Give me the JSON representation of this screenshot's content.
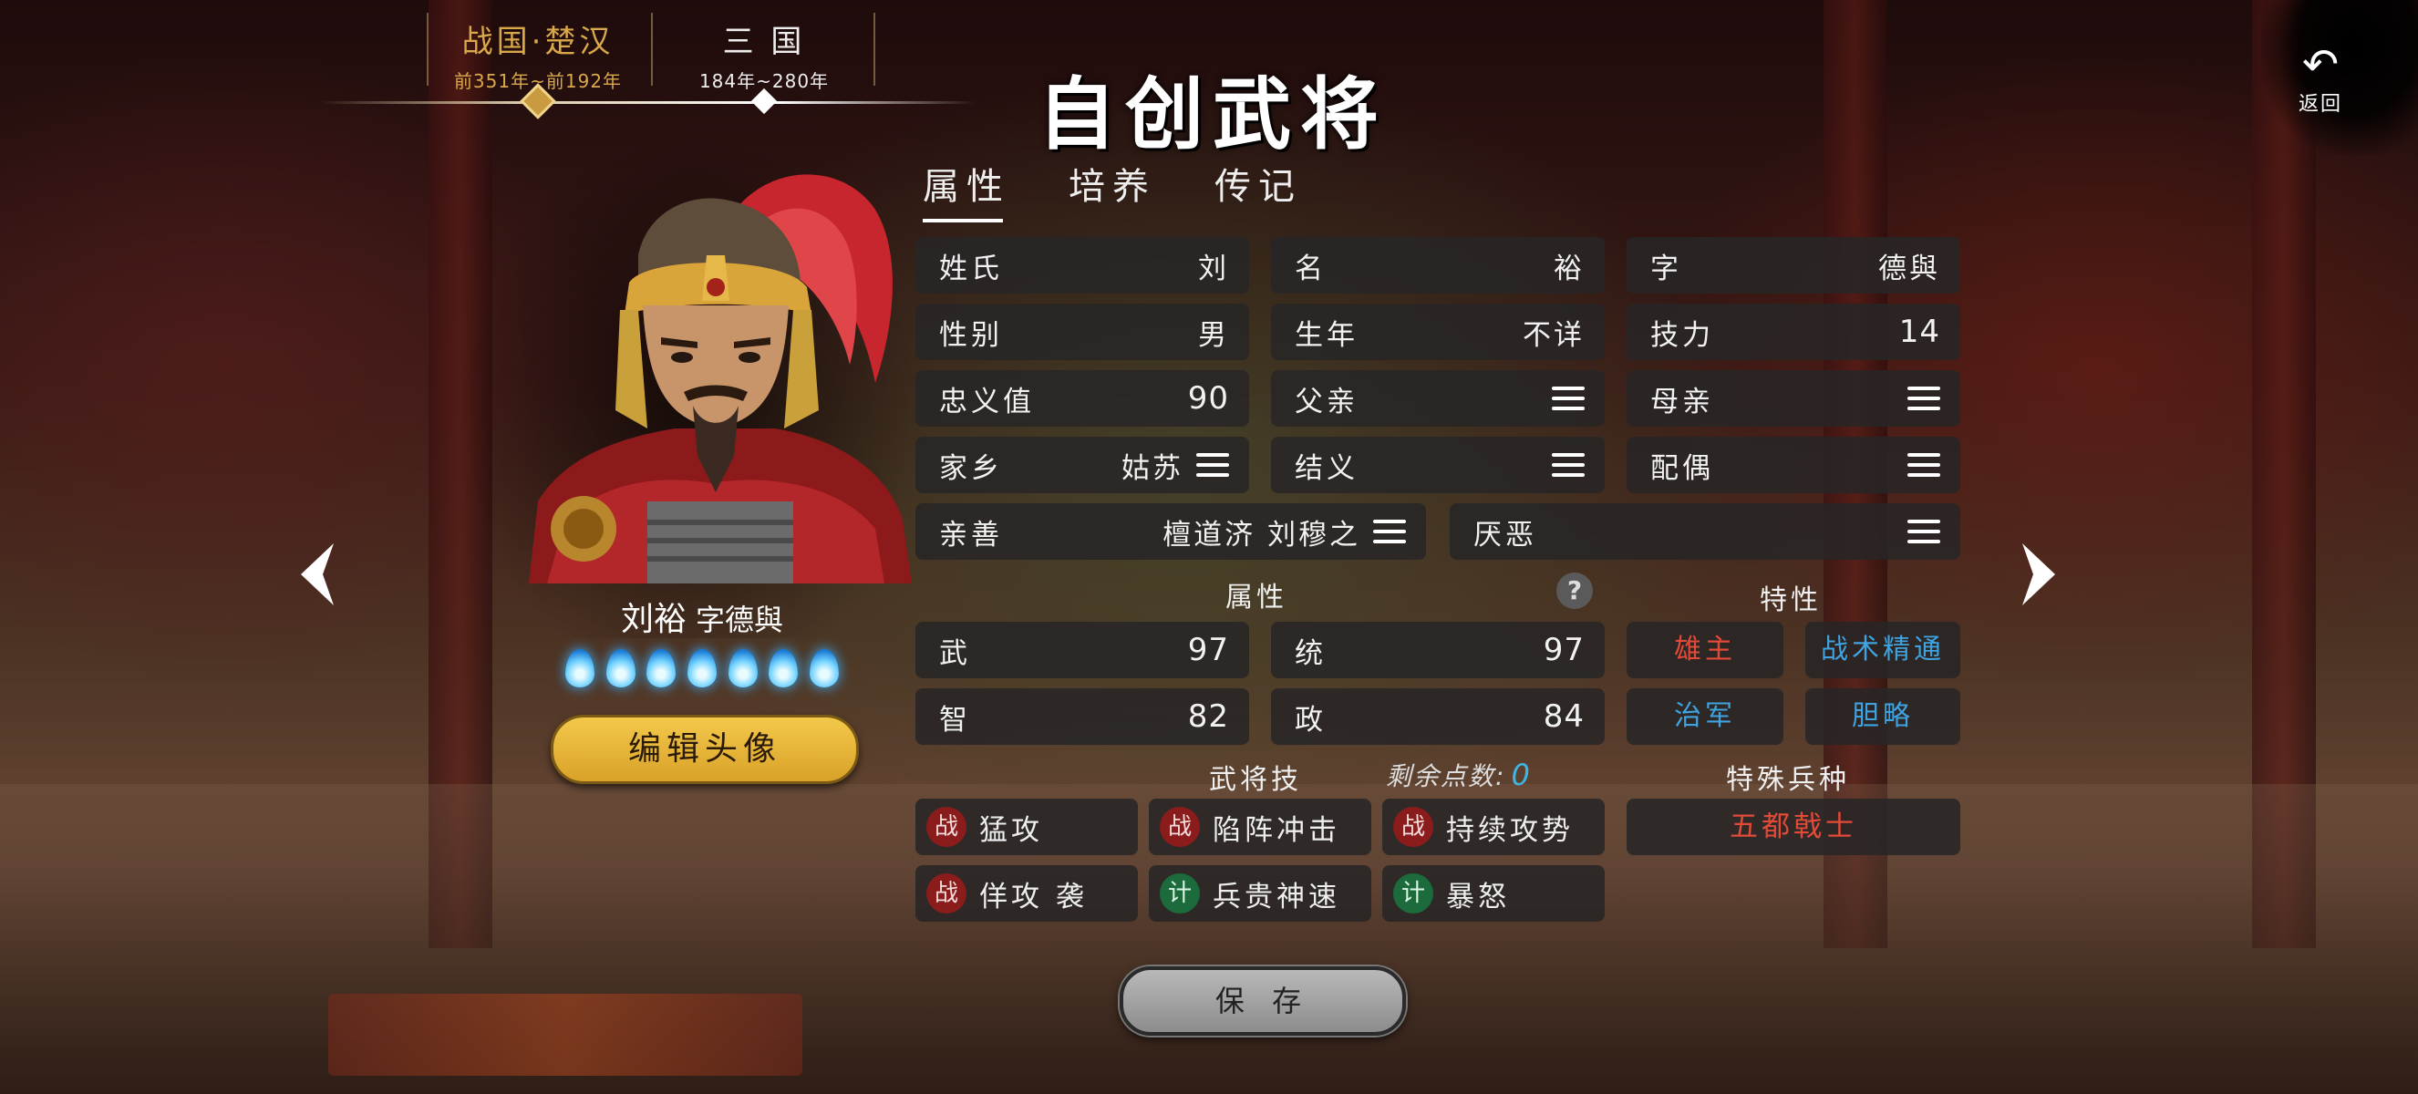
{
  "title": "自创武将",
  "back": {
    "label": "返回"
  },
  "eras": [
    {
      "name": "战国·楚汉",
      "range": "前351年~前192年"
    },
    {
      "name": "三 国",
      "range": "184年~280年"
    }
  ],
  "tabs": [
    "属性",
    "培养",
    "传记"
  ],
  "hero": {
    "name": "刘裕",
    "courtesy": "字德與",
    "star_flames": 7,
    "edit_portrait_label": "编辑头像"
  },
  "basic": {
    "surname": {
      "label": "姓氏",
      "value": "刘"
    },
    "given_name": {
      "label": "名",
      "value": "裕"
    },
    "courtesy_name": {
      "label": "字",
      "value": "德與"
    },
    "gender": {
      "label": "性别",
      "value": "男"
    },
    "birth_year": {
      "label": "生年",
      "value": "不详"
    },
    "skill_power": {
      "label": "技力",
      "value": "14"
    },
    "loyalty": {
      "label": "忠义值",
      "value": "90"
    },
    "father": {
      "label": "父亲",
      "value": ""
    },
    "mother": {
      "label": "母亲",
      "value": ""
    },
    "hometown": {
      "label": "家乡",
      "value": "姑苏"
    },
    "sworn": {
      "label": "结义",
      "value": ""
    },
    "spouse": {
      "label": "配偶",
      "value": ""
    },
    "friends": {
      "label": "亲善",
      "value": "檀道济 刘穆之"
    },
    "dislikes": {
      "label": "厌恶",
      "value": ""
    }
  },
  "attributes": {
    "heading": "属性",
    "help": "?",
    "war": {
      "label": "武",
      "value": "97"
    },
    "command": {
      "label": "统",
      "value": "97"
    },
    "intellect": {
      "label": "智",
      "value": "82"
    },
    "politics": {
      "label": "政",
      "value": "84"
    }
  },
  "traits": {
    "heading": "特性",
    "items": [
      {
        "label": "雄主",
        "color": "#e34a38"
      },
      {
        "label": "战术精通",
        "color": "#3fa3e0"
      },
      {
        "label": "治军",
        "color": "#3fa3e0"
      },
      {
        "label": "胆略",
        "color": "#3fa3e0"
      }
    ]
  },
  "skills": {
    "heading": "武将技",
    "remaining_label": "剩余点数:",
    "remaining_value": "0",
    "items": [
      {
        "type": "战",
        "label": "猛攻"
      },
      {
        "type": "战",
        "label": "陷阵冲击"
      },
      {
        "type": "战",
        "label": "持续攻势"
      },
      {
        "type": "战",
        "label": "佯攻 袭"
      },
      {
        "type": "计",
        "label": "兵贵神速"
      },
      {
        "type": "计",
        "label": "暴怒"
      }
    ]
  },
  "special_troop": {
    "heading": "特殊兵种",
    "value": "五都戟士"
  },
  "save_label": "保 存",
  "colors": {
    "accent_gold": "#d9a84a",
    "trait_red": "#e34a38",
    "trait_blue": "#3fa3e0"
  }
}
